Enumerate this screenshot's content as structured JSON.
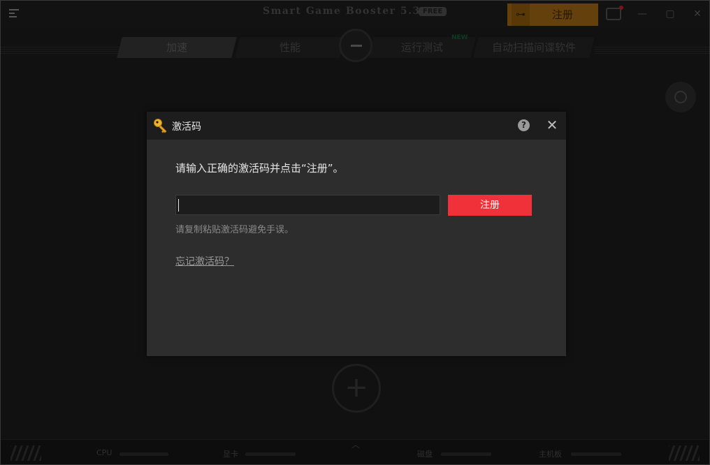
{
  "titlebar": {
    "app_title": "Smart Game Booster 5.3",
    "free_badge": "FREE",
    "register_label": "注册",
    "minimize": "—",
    "maximize": "▢",
    "close": "✕"
  },
  "tabs": [
    {
      "label": "加速"
    },
    {
      "label": "性能"
    },
    {
      "label": "运行测试"
    },
    {
      "label": "自动扫描间谍软件"
    }
  ],
  "new_badge": "NEW",
  "bottombar": {
    "metrics": [
      {
        "label": "CPU"
      },
      {
        "label": "显卡"
      },
      {
        "label": "磁盘"
      },
      {
        "label": "主机板"
      }
    ]
  },
  "dialog": {
    "title": "激活码",
    "help": "?",
    "close": "✕",
    "instruction": "请输入正确的激活码并点击“注册”。",
    "input_value": "",
    "register_button": "注册",
    "hint": "请复制粘贴激活码避免手误。",
    "forgot_link": "忘记激活码？"
  },
  "colors": {
    "register_red": "#f0313a",
    "register_orange": "#7a4f0f",
    "dialog_bg": "#2d2d2d"
  },
  "icons": [
    "menu-icon",
    "key-icon",
    "help-icon",
    "close-icon",
    "notify-icon",
    "block-icon",
    "add-icon"
  ]
}
